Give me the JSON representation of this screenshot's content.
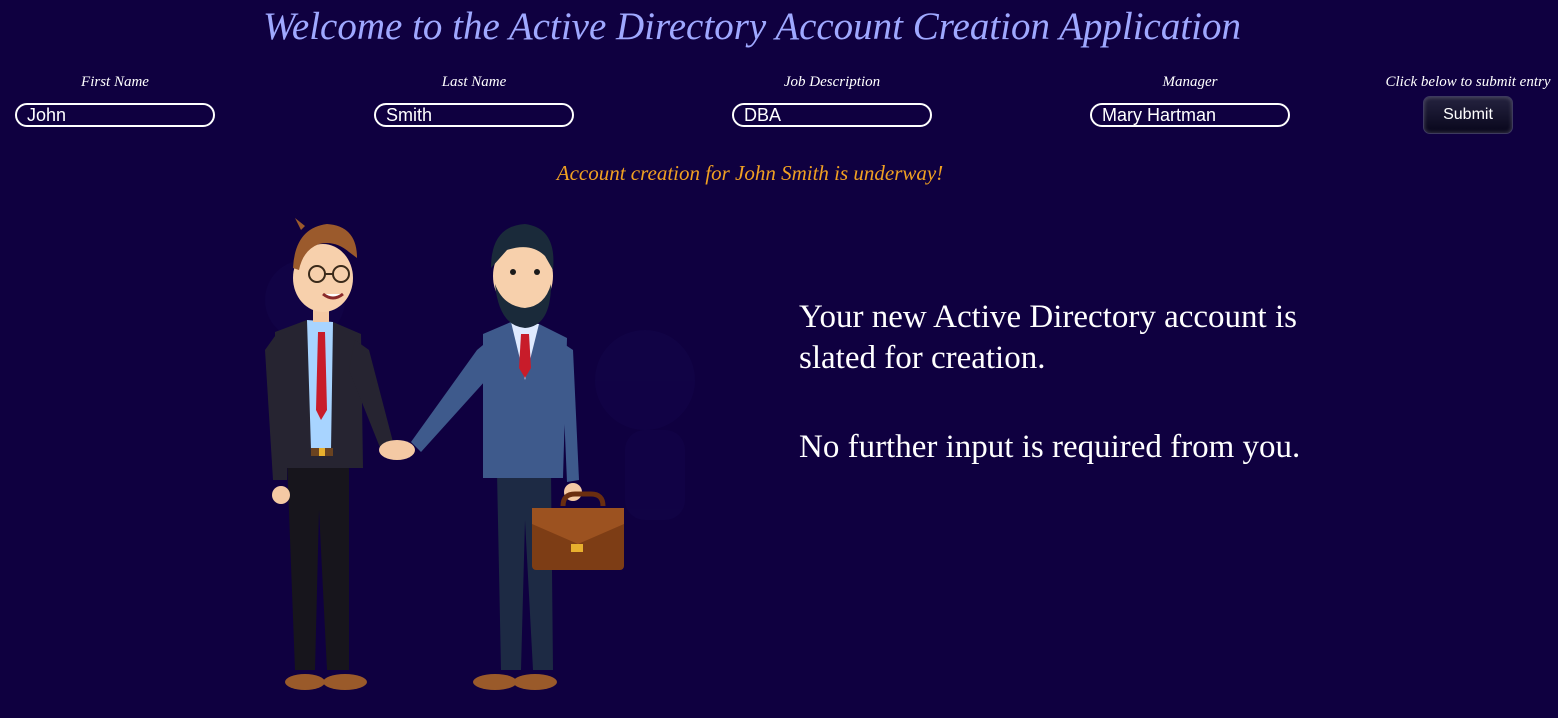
{
  "header": {
    "title": "Welcome to the Active Directory Account Creation Application"
  },
  "form": {
    "first_name": {
      "label": "First Name",
      "value": "John"
    },
    "last_name": {
      "label": "Last Name",
      "value": "Smith"
    },
    "job_description": {
      "label": "Job Description",
      "value": "DBA"
    },
    "manager": {
      "label": "Manager",
      "value": "Mary Hartman"
    },
    "submit": {
      "label": "Click below to submit entry",
      "button": "Submit"
    }
  },
  "status": {
    "text": "Account creation for John Smith is underway!",
    "color": "#f0a022"
  },
  "message": {
    "line1": "Your new Active Directory account is slated for creation.",
    "line2": "No further input is required from you."
  },
  "illustration": {
    "icon": "handshake-businessmen-illustration"
  },
  "colors": {
    "background": "#0f0040",
    "title": "#9fa8ff"
  }
}
